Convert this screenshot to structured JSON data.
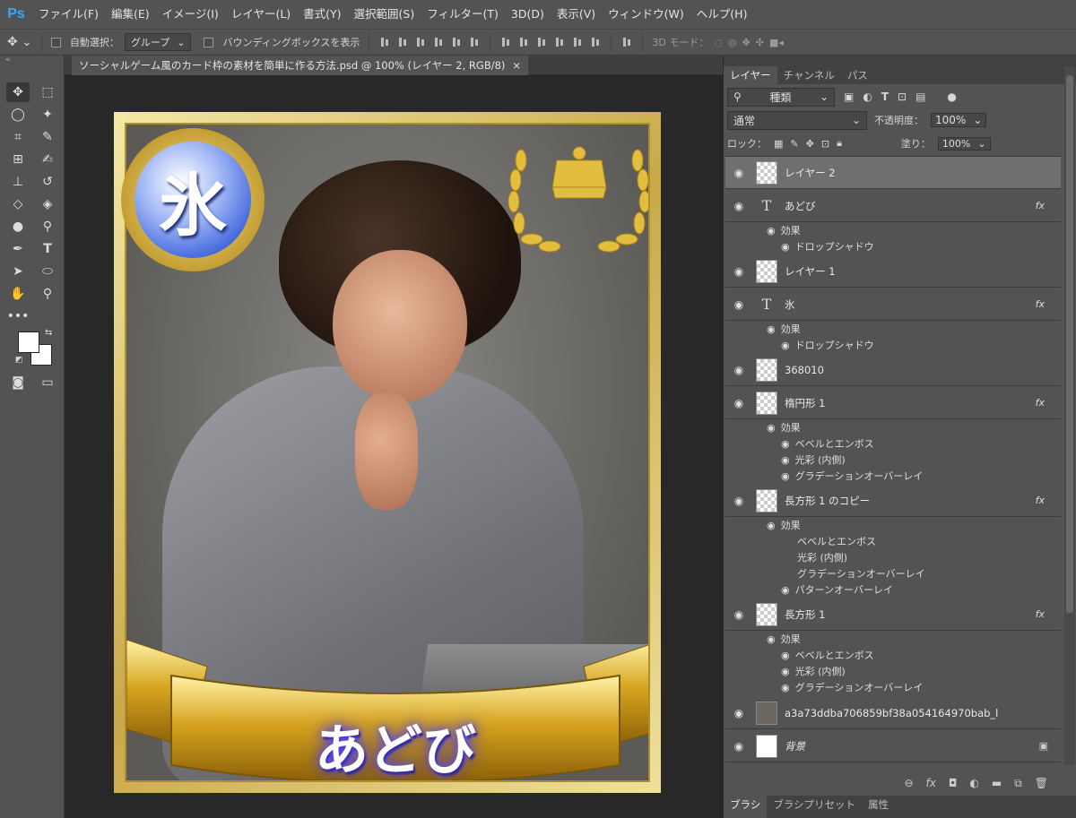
{
  "app": {
    "logo": "Ps"
  },
  "menu": [
    "ファイル(F)",
    "編集(E)",
    "イメージ(I)",
    "レイヤー(L)",
    "書式(Y)",
    "選択範囲(S)",
    "フィルター(T)",
    "3D(D)",
    "表示(V)",
    "ウィンドウ(W)",
    "ヘルプ(H)"
  ],
  "options": {
    "auto_select_label": "自動選択：",
    "auto_select_value": "グループ",
    "bbox_label": "バウンディングボックスを表示",
    "mode_3d_label": "3D モード："
  },
  "document": {
    "tab_title": "ソーシャルゲーム風のカード枠の素材を簡単に作る方法.psd @ 100% (レイヤー 2, RGB/8)",
    "close": "×"
  },
  "card": {
    "badge_char": "氷",
    "name": "あどび"
  },
  "panel": {
    "tabs": [
      "レイヤー",
      "チャンネル",
      "パス"
    ],
    "filter_kind": "種類",
    "blend_mode": "通常",
    "opacity_label": "不透明度：",
    "opacity_value": "100%",
    "lock_label": "ロック：",
    "fill_label": "塗り：",
    "fill_value": "100%",
    "fx_symbol": "fx"
  },
  "layers": [
    {
      "name": "レイヤー 2",
      "type": "pixel",
      "selected": true
    },
    {
      "name": "あどび",
      "type": "text",
      "fx": true,
      "effects": [
        "効果",
        "ドロップシャドウ"
      ]
    },
    {
      "name": "レイヤー 1",
      "type": "pixel"
    },
    {
      "name": "氷",
      "type": "text",
      "fx": true,
      "effects": [
        "効果",
        "ドロップシャドウ"
      ]
    },
    {
      "name": "368010",
      "type": "smart"
    },
    {
      "name": "楕円形 1",
      "type": "shape",
      "fx": true,
      "effects": [
        "効果",
        "ベベルとエンボス",
        "光彩 (内側)",
        "グラデーションオーバーレイ"
      ]
    },
    {
      "name": "長方形 1 のコピー",
      "type": "shape",
      "fx": true,
      "effects": [
        "効果",
        "ベベルとエンボス",
        "光彩 (内側)",
        "グラデーションオーバーレイ",
        "パターンオーバーレイ"
      ]
    },
    {
      "name": "長方形 1",
      "type": "shape",
      "fx": true,
      "effects": [
        "効果",
        "ベベルとエンボス",
        "光彩 (内側)",
        "グラデーションオーバーレイ"
      ]
    },
    {
      "name": "a3a73ddba706859bf38a054164970bab_l",
      "type": "smart"
    },
    {
      "name": "背景",
      "type": "background",
      "locked": true
    }
  ],
  "bottom_tabs": [
    "ブラシ",
    "ブラシプリセット",
    "属性"
  ],
  "colors": {
    "accent": "#31a8ff",
    "panel_bg": "#535353",
    "canvas_bg": "#282828",
    "gold": "#d4b24a",
    "orb_blue": "#2b54d6"
  }
}
